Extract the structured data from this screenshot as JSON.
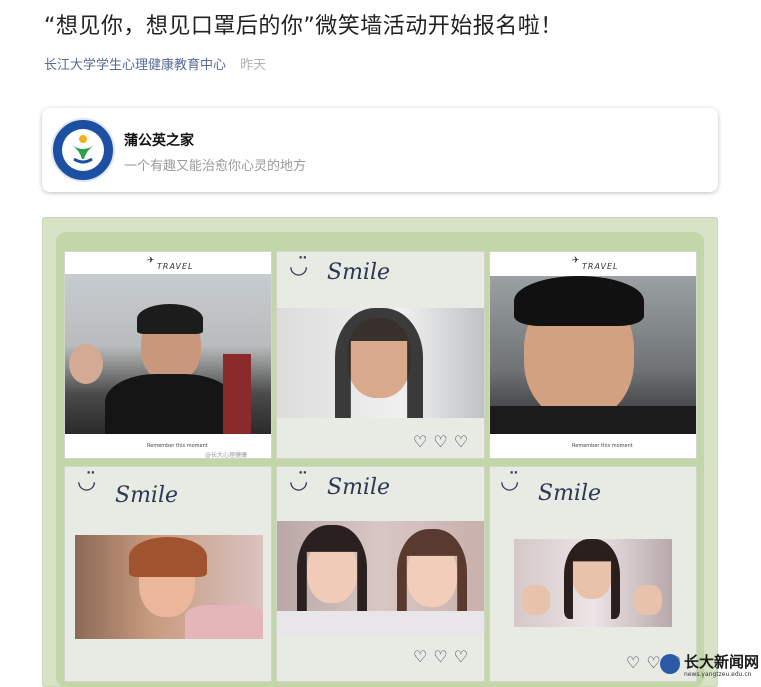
{
  "article": {
    "title": "“想见你，想见口罩后的你”微笑墙活动开始报名啦！",
    "source": "长江大学学生心理健康教育中心",
    "date": "昨天"
  },
  "account_card": {
    "name": "蒲公英之家",
    "description": "一个有趣又能治愈你心灵的地方",
    "logo_icon": "psych-center-logo"
  },
  "wall": {
    "travel_label": "TRAVEL",
    "caption": "Remember this moment",
    "smile_label": "Smile",
    "hearts": "♡♡♡",
    "weibo_mark": "@长大心理健康",
    "tile_colors": {
      "frame": "#e7ebe4",
      "board": "#c3d6a7",
      "ink": "#2e3752"
    }
  },
  "site_watermark": {
    "name": "长大新闻网",
    "url": "news.yangtzeu.edu.cn"
  }
}
